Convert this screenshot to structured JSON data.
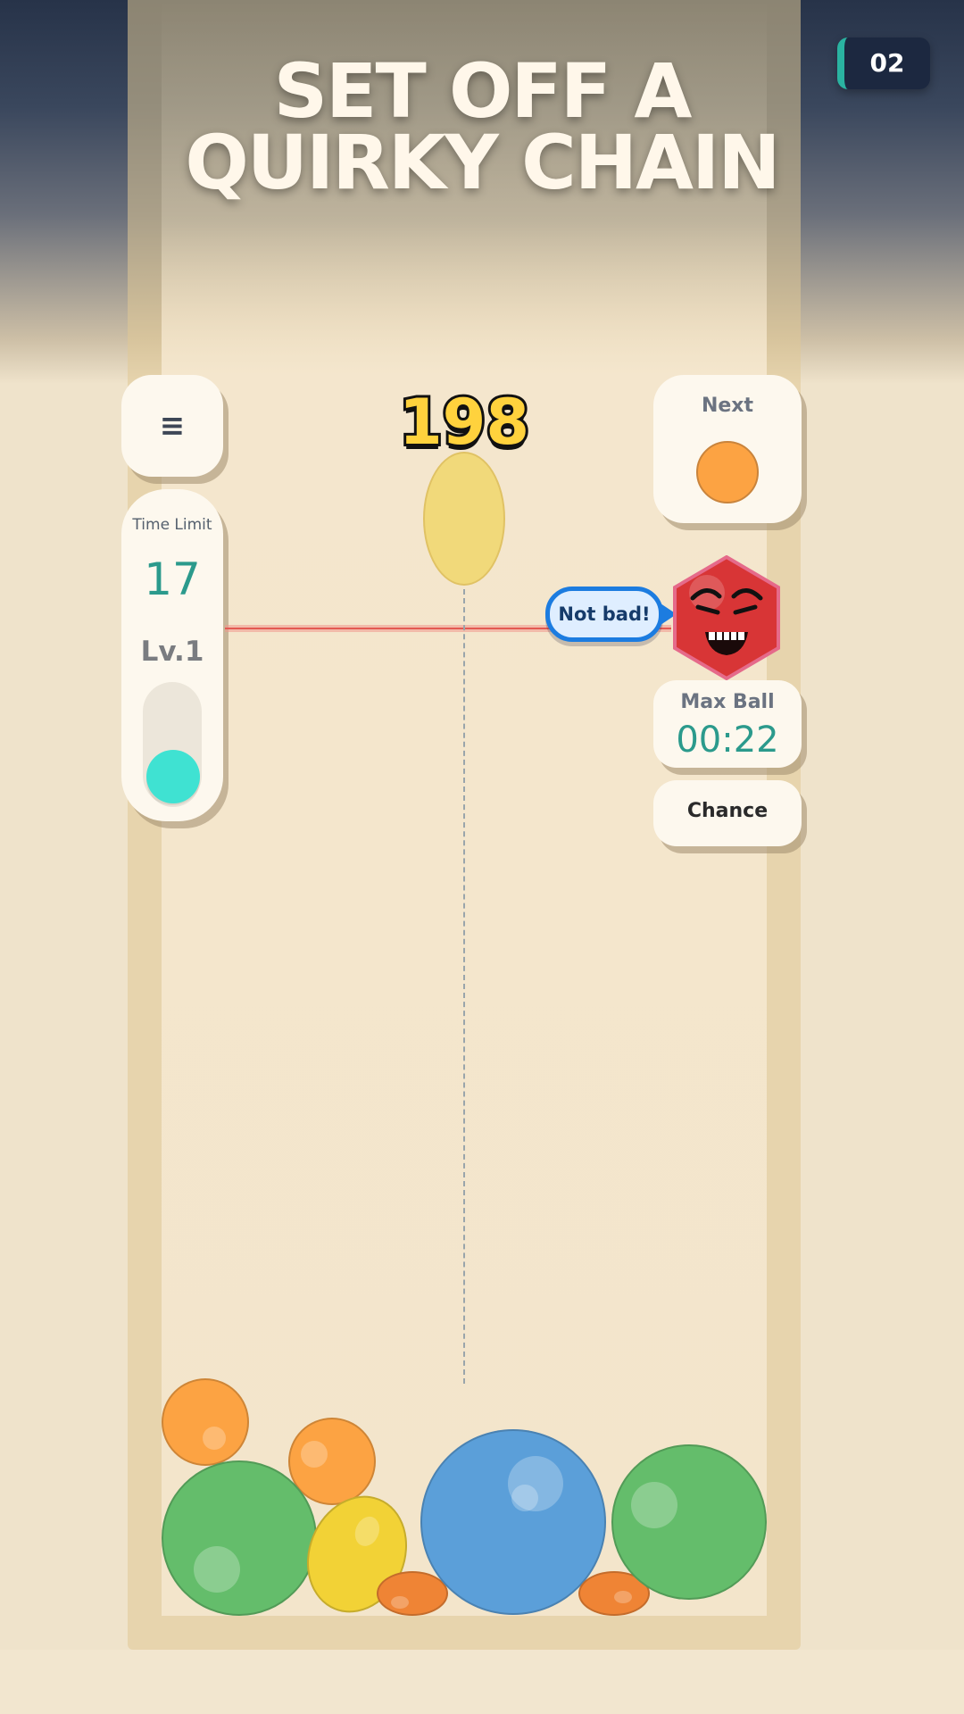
{
  "headline": {
    "line1": "SET OFF A",
    "line2": "QUIRKY CHAIN"
  },
  "page_number": "02",
  "menu": {
    "icon": "hamburger-menu-icon",
    "glyph": "≡"
  },
  "score": "198",
  "time_limit": {
    "label": "Time Limit",
    "value": "17",
    "level": "Lv.1",
    "level_fill_fraction": 0.3
  },
  "next": {
    "label": "Next",
    "ball_color": "#fca343"
  },
  "max_ball": {
    "label": "Max Ball",
    "time": "00:22"
  },
  "chance": {
    "label": "Chance"
  },
  "speech_bubble": {
    "text": "Not bad!"
  },
  "mascot": {
    "icon": "angry-red-hexagon-mascot-icon",
    "color": "#d83536"
  },
  "drop_ball": {
    "color": "#f1d97a"
  },
  "colors": {
    "accent_teal": "#2ab3a1",
    "limit_line": "#e35a52",
    "score_fill": "#ffd23d",
    "bubble_border": "#1c7ce0"
  },
  "balls": [
    {
      "kind": "orange",
      "color": "#fca343"
    },
    {
      "kind": "orange",
      "color": "#fca343"
    },
    {
      "kind": "green",
      "color": "#64bd6b"
    },
    {
      "kind": "yellow",
      "color": "#f2d236"
    },
    {
      "kind": "small-orange",
      "color": "#ef8435"
    },
    {
      "kind": "blue",
      "color": "#5b9fd9"
    },
    {
      "kind": "small-orange",
      "color": "#ef8435"
    },
    {
      "kind": "green",
      "color": "#64bd6b"
    }
  ]
}
